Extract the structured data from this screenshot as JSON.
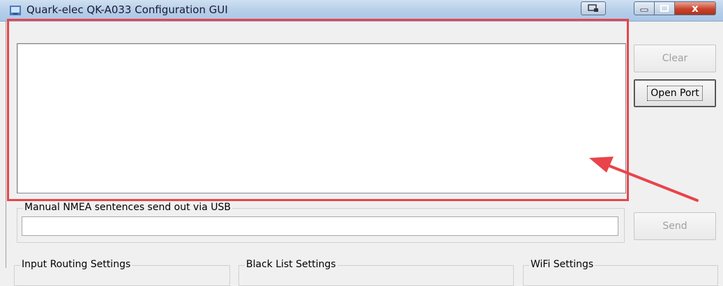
{
  "window": {
    "title": "Quark-elec QK-A033 Configuration GUI",
    "close_glyph": "x",
    "icon": "app-icon"
  },
  "log": {
    "value": ""
  },
  "buttons": {
    "clear": "Clear",
    "open_port": "Open Port",
    "send": "Send"
  },
  "nmea": {
    "legend": "Manual NMEA sentences send out via USB",
    "value": ""
  },
  "groups": {
    "input_routing": "Input Routing Settings",
    "black_list": "Black List Settings",
    "wifi": "WiFi Settings"
  },
  "colors": {
    "highlight": "#e8444a",
    "title_bar": "#b8d0ea",
    "close_button": "#c8442b"
  }
}
